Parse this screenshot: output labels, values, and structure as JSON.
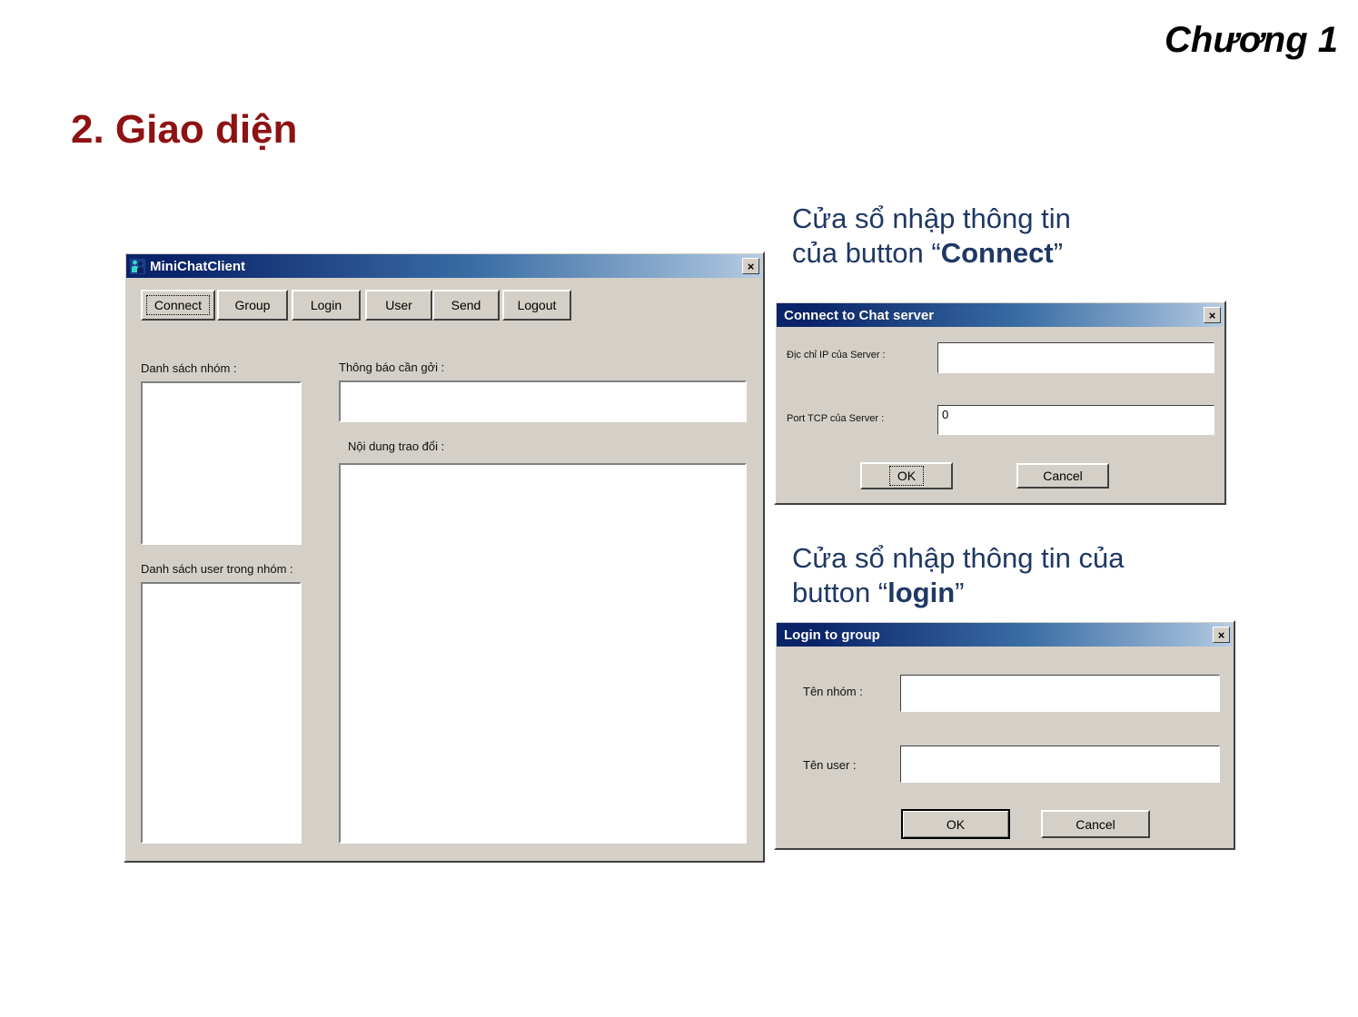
{
  "slide": {
    "chapter_label": "Chương 1",
    "title": "2. Giao diện"
  },
  "main_window": {
    "title": "MiniChatClient",
    "icon": "chat-people-icon",
    "close_label": "×",
    "toolbar": [
      {
        "label": "Connect",
        "focused": true
      },
      {
        "label": "Group",
        "focused": false
      },
      {
        "label": "Login",
        "focused": false
      },
      {
        "label": "User",
        "focused": false
      },
      {
        "label": "Send",
        "focused": false
      },
      {
        "label": "Logout",
        "focused": false
      }
    ],
    "labels": {
      "group_list": "Danh sách nhóm :",
      "user_list": "Danh sách user trong nhóm :",
      "message_to_send": "Thông báo cần gởi :",
      "conversation": "Nội dung trao đổi :"
    },
    "values": {
      "group_list": "",
      "user_list": "",
      "message_to_send": "",
      "conversation": ""
    }
  },
  "annotations": {
    "connect": "Cửa sổ nhập thông tin\ncủa button “",
    "connect_bold": "Connect",
    "connect_tail": "”",
    "login": "Cửa sổ nhập thông tin của\nbutton “",
    "login_bold": "login",
    "login_tail": "”"
  },
  "connect_dialog": {
    "title": "Connect to Chat server",
    "close_label": "×",
    "fields": [
      {
        "label": "Địc chỉ IP của Server :",
        "value": ""
      },
      {
        "label": "Port TCP của Server :",
        "value": "0"
      }
    ],
    "buttons": [
      {
        "label": "OK",
        "focused": true,
        "default": false
      },
      {
        "label": "Cancel",
        "focused": false,
        "default": false
      }
    ]
  },
  "login_dialog": {
    "title": "Login to group",
    "close_label": "×",
    "fields": [
      {
        "label": "Tên nhóm :",
        "value": ""
      },
      {
        "label": "Tên user :",
        "value": ""
      }
    ],
    "buttons": [
      {
        "label": "OK",
        "focused": false,
        "default": true
      },
      {
        "label": "Cancel",
        "focused": false,
        "default": false
      }
    ]
  },
  "colors": {
    "title_accent": "#8e1212",
    "annotation": "#1f3864",
    "window_face": "#d4d0c8",
    "titlebar_start": "#0a246a"
  }
}
